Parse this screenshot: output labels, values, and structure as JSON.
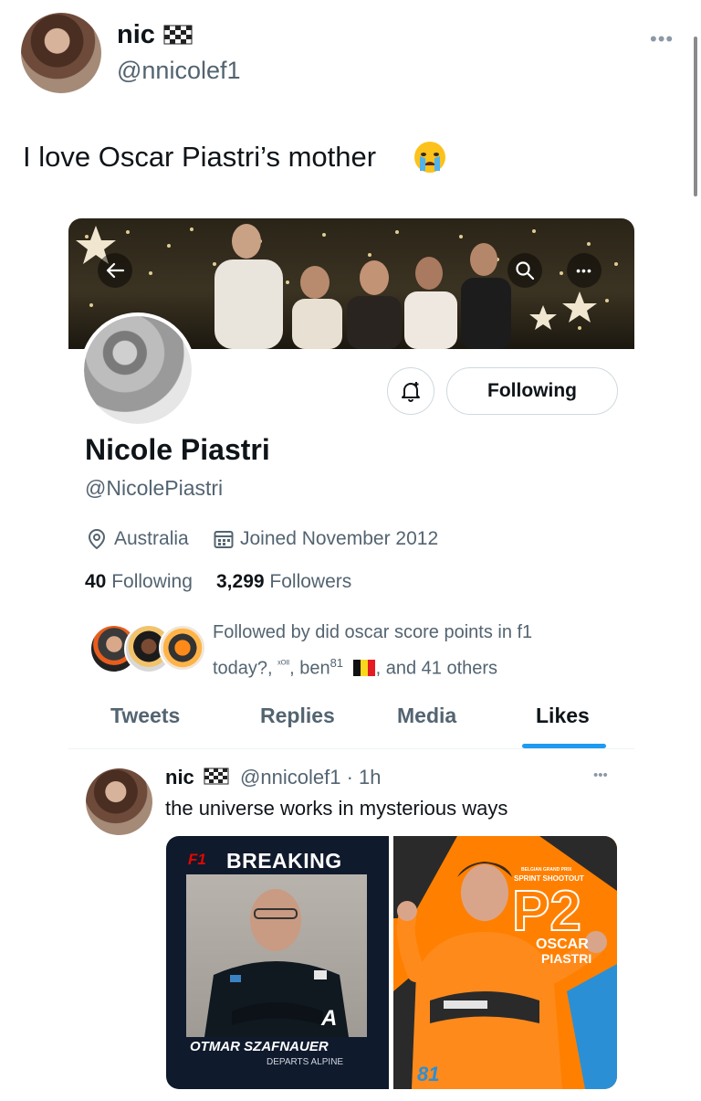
{
  "outer_tweet": {
    "author_name": "nic",
    "author_flag_icon": "checkered-flag-icon",
    "handle": "@nnicolef1",
    "text": "I love Oscar Piastri’s mother",
    "emoji": "crying-face-icon"
  },
  "profile": {
    "name": "Nicole Piastri",
    "handle": "@NicolePiastri",
    "location": "Australia",
    "joined": "Joined November 2012",
    "following_count": "40",
    "following_label": "Following",
    "followers_count": "3,299",
    "followers_label": "Followers",
    "follow_button": "Following",
    "followed_by_line1": "Followed by did oscar score points in f1",
    "followed_by_line2_a": "today?, ",
    "followed_by_xoi": "ˣᴼᴵᴵ",
    "followed_by_line2_b": ", ben",
    "followed_by_sup": "81",
    "followed_by_line2_c": ", and 41 others"
  },
  "tabs": [
    {
      "label": "Tweets"
    },
    {
      "label": "Replies"
    },
    {
      "label": "Media"
    },
    {
      "label": "Likes"
    }
  ],
  "liked_tweet": {
    "author_name": "nic",
    "handle": "@nnicolef1",
    "time": "· 1h",
    "text": "the universe works in mysterious ways",
    "media_left": {
      "logo": "F1",
      "headline": "BREAKING",
      "name": "OTMAR SZAFNAUER",
      "subline": "DEPARTS ALPINE"
    },
    "media_right": {
      "event": "BELGIAN GRAND PRIX",
      "session": "SPRINT SHOOTOUT",
      "position": "P2",
      "driver_first": "OSCAR",
      "driver_last": "PIASTRI",
      "car_number": "81"
    }
  },
  "colors": {
    "accent": "#1d9bf0",
    "text": "#0f1419",
    "muted": "#536471",
    "border": "#cfd9de",
    "papaya": "#ff8000"
  }
}
